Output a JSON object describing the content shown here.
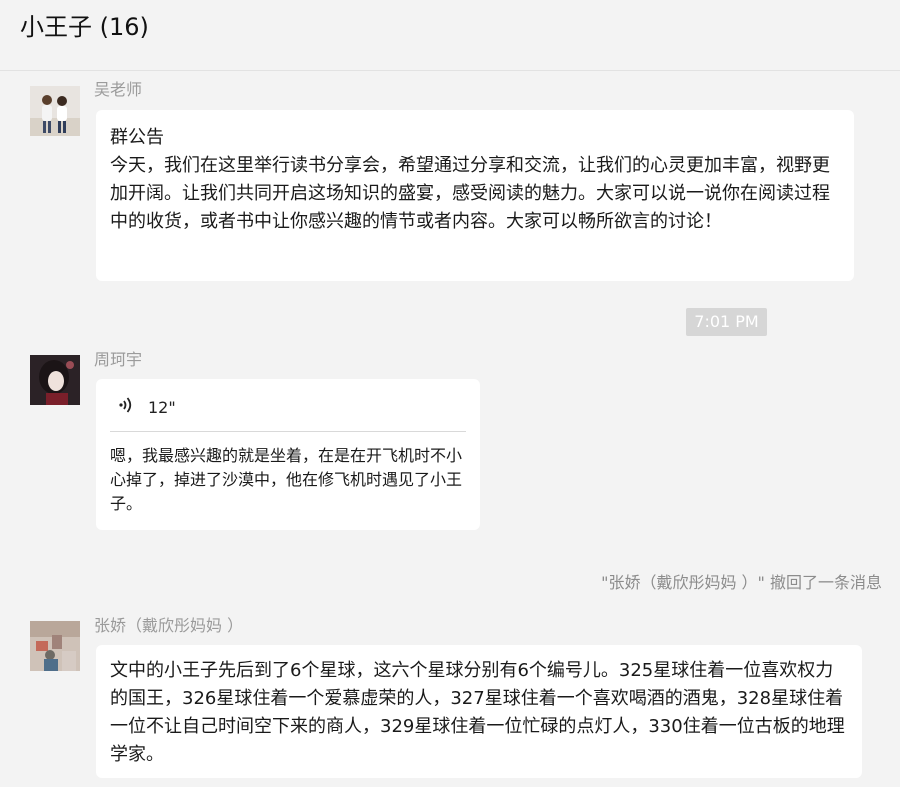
{
  "header": {
    "title": "小王子 (16)"
  },
  "messages": [
    {
      "sender": "吴老师",
      "type": "notice",
      "notice_title": "群公告",
      "text": "今天，我们在这里举行读书分享会，希望通过分享和交流，让我们的心灵更加丰富，视野更加开阔。让我们共同开启这场知识的盛宴，感受阅读的魅力。大家可以说一说你在阅读过程中的收货，或者书中让你感兴趣的情节或者内容。大家可以畅所欲言的讨论！"
    },
    {
      "sender": "周珂宇",
      "type": "voice",
      "duration": "12\"",
      "transcript": "嗯，我最感兴趣的就是坐着，在是在开飞机时不小心掉了，掉进了沙漠中，他在修飞机时遇见了小王子。"
    },
    {
      "sender": "张娇（戴欣彤妈妈 ）",
      "type": "text",
      "text": "文中的小王子先后到了6个星球，这六个星球分别有6个编号儿。325星球住着一位喜欢权力的国王，326星球住着一个爱慕虚荣的人，327星球住着一个喜欢喝酒的酒鬼，328星球住着一位不让自己时间空下来的商人，329星球住着一位忙碌的点灯人，330住着一位古板的地理学家。"
    }
  ],
  "timestamp": "7:01 PM",
  "recall_notice": "\"张娇（戴欣彤妈妈 ）\" 撤回了一条消息",
  "icons": {
    "voice": "voice-wave-icon"
  }
}
